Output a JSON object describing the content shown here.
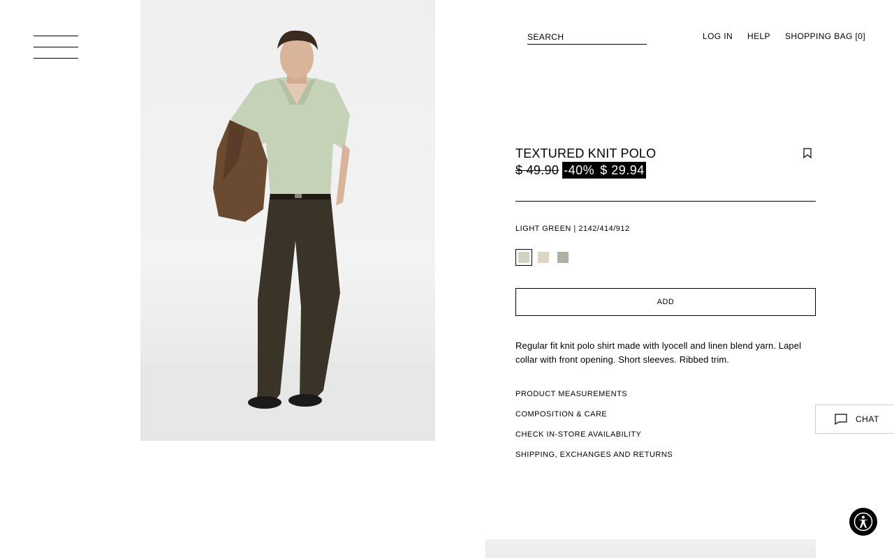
{
  "header": {
    "menu_icon": "hamburger-icon",
    "search_placeholder": "SEARCH",
    "login_label": "LOG IN",
    "help_label": "HELP",
    "bag_label": "SHOPPING BAG [0]"
  },
  "product": {
    "title": "TEXTURED KNIT POLO",
    "bookmark_icon": "bookmark-icon",
    "old_price": "$ 49.90",
    "discount": "-40%",
    "sale_price": "$ 29.94",
    "color_info": "LIGHT GREEN | 2142/414/912",
    "swatches": [
      {
        "color": "#cfd3bf",
        "selected": true
      },
      {
        "color": "#ded6c2",
        "selected": false
      },
      {
        "color": "#aeb1a3",
        "selected": false
      }
    ],
    "add_label": "ADD",
    "description": "Regular fit knit polo shirt made with lyocell and linen blend yarn. Lapel collar with front opening. Short sleeves. Ribbed trim.",
    "links": [
      "PRODUCT MEASUREMENTS",
      "COMPOSITION & CARE",
      "CHECK IN-STORE AVAILABILITY",
      "SHIPPING, EXCHANGES AND RETURNS"
    ]
  },
  "chat": {
    "label": "CHAT",
    "icon": "chat-bubble-icon"
  },
  "accessibility": {
    "icon": "accessibility-icon"
  },
  "colors": {
    "text": "#000000",
    "background": "#ffffff",
    "polo": "#c6d2b8",
    "trousers": "#3a3327",
    "jacket": "#6b4a32"
  }
}
